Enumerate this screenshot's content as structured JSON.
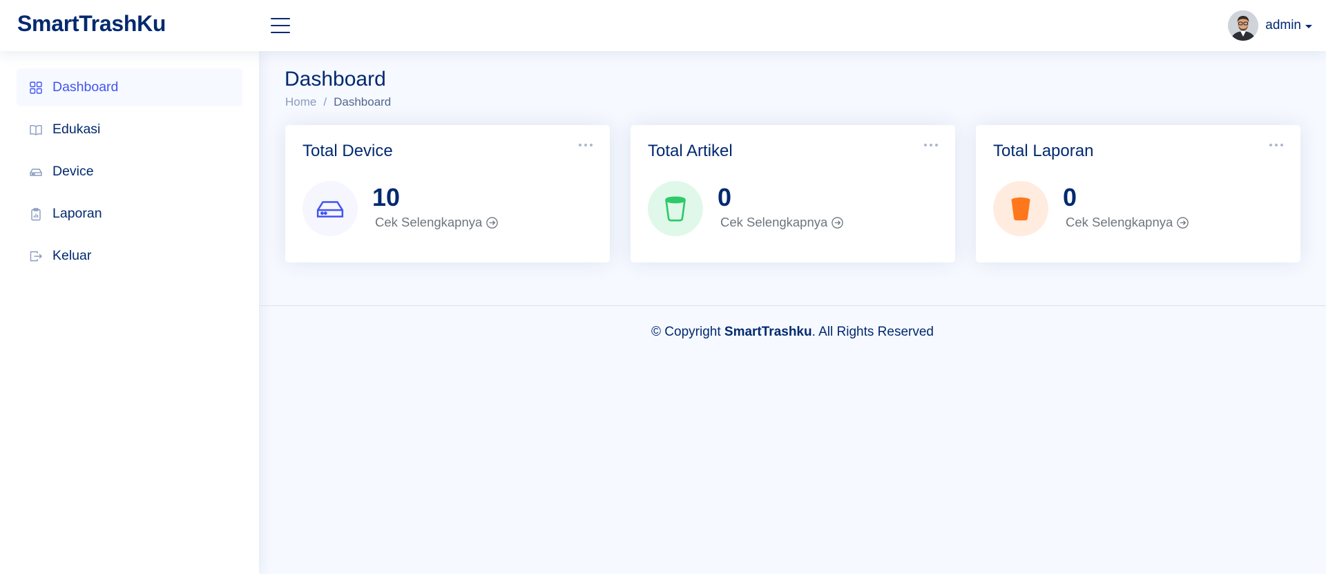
{
  "header": {
    "brand": "SmartTrashKu",
    "user_name": "admin"
  },
  "sidebar": {
    "items": [
      {
        "label": "Dashboard",
        "icon": "grid-icon",
        "active": true
      },
      {
        "label": "Edukasi",
        "icon": "book-icon"
      },
      {
        "label": "Device",
        "icon": "hdd-icon"
      },
      {
        "label": "Laporan",
        "icon": "clipboard-icon"
      },
      {
        "label": "Keluar",
        "icon": "logout-icon"
      }
    ]
  },
  "page": {
    "title": "Dashboard",
    "breadcrumb": [
      "Home",
      "Dashboard"
    ]
  },
  "cards": [
    {
      "title": "Total Device",
      "value": "10",
      "link": "Cek Selengkapnya",
      "icon": "hdd-icon",
      "color": "#4154f1",
      "bg": "#f6f6fe"
    },
    {
      "title": "Total Artikel",
      "value": "0",
      "link": "Cek Selengkapnya",
      "icon": "cup-icon",
      "color": "#2eca6a",
      "bg": "#e0f8e9"
    },
    {
      "title": "Total Laporan",
      "value": "0",
      "link": "Cek Selengkapnya",
      "icon": "bucket-fill-icon",
      "color": "#ff771d",
      "bg": "#ffecdf"
    }
  ],
  "footer": {
    "prefix": "© Copyright ",
    "brand": "SmartTrashku",
    "suffix": ". All Rights Reserved"
  }
}
